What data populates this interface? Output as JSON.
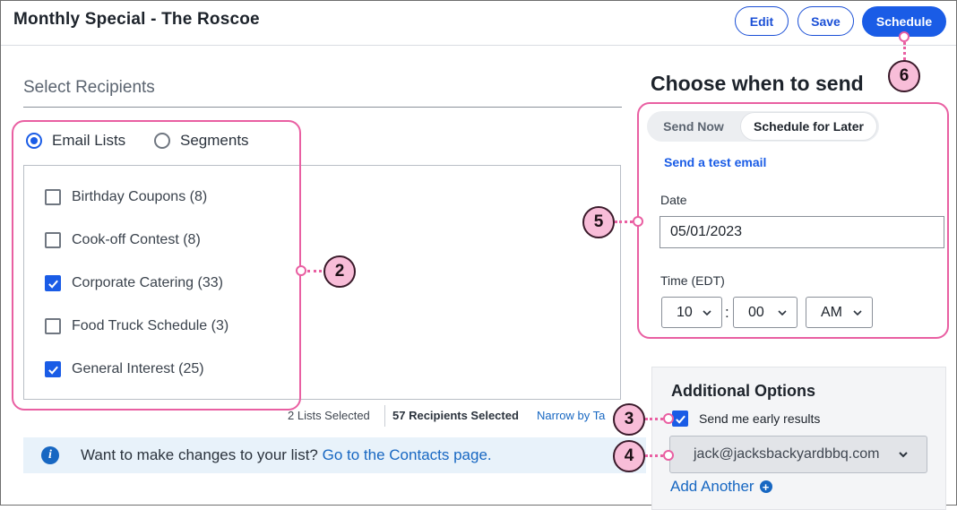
{
  "header": {
    "title": "Monthly Special - The Roscoe",
    "edit_label": "Edit",
    "save_label": "Save",
    "schedule_label": "Schedule"
  },
  "recipients": {
    "heading": "Select Recipients",
    "tabs": [
      {
        "label": "Email Lists",
        "selected": true
      },
      {
        "label": "Segments",
        "selected": false
      }
    ],
    "lists": [
      {
        "label": "Birthday Coupons (8)",
        "checked": false
      },
      {
        "label": "Cook-off Contest (8)",
        "checked": false
      },
      {
        "label": "Corporate Catering (33)",
        "checked": true
      },
      {
        "label": "Food Truck Schedule (3)",
        "checked": false
      },
      {
        "label": "General Interest (25)",
        "checked": true
      }
    ],
    "lists_selected": "2 Lists Selected",
    "recipients_selected": "57 Recipients Selected",
    "narrow_link": "Narrow by Ta"
  },
  "info_bar": {
    "text": "Want to make changes to your list?",
    "link": "Go to the Contacts page."
  },
  "schedule": {
    "heading": "Choose when to send",
    "send_now": "Send Now",
    "schedule_later": "Schedule for Later",
    "test_email_link": "Send a test email",
    "date_label": "Date",
    "date_value": "05/01/2023",
    "time_label": "Time (EDT)",
    "hour": "10",
    "minute": "00",
    "ampm": "AM"
  },
  "additional": {
    "heading": "Additional Options",
    "early_results_label": "Send me early results",
    "early_results_checked": true,
    "email_value": "jack@jacksbackyardbbq.com",
    "add_another": "Add Another"
  },
  "callouts": [
    "2",
    "3",
    "4",
    "5",
    "6"
  ],
  "colors": {
    "accent": "#1a5ce6",
    "link": "#1767c2",
    "callout_border": "#e95fa2",
    "callout_fill": "#f8bdd8"
  }
}
